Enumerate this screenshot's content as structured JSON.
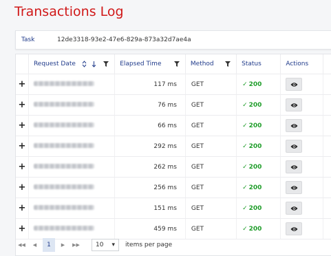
{
  "page_title": "Transactions Log",
  "task": {
    "label": "Task",
    "value": "12de3318-93e2-47e6-829a-873a32d7ae4a"
  },
  "columns": {
    "request_date": "Request Date",
    "elapsed_time": "Elapsed Time",
    "method": "Method",
    "status": "Status",
    "actions": "Actions"
  },
  "rows": [
    {
      "expand": "+",
      "elapsed": "117 ms",
      "method": "GET",
      "status": "200"
    },
    {
      "expand": "+",
      "elapsed": "76 ms",
      "method": "GET",
      "status": "200"
    },
    {
      "expand": "+",
      "elapsed": "66 ms",
      "method": "GET",
      "status": "200"
    },
    {
      "expand": "+",
      "elapsed": "292 ms",
      "method": "GET",
      "status": "200"
    },
    {
      "expand": "+",
      "elapsed": "262 ms",
      "method": "GET",
      "status": "200"
    },
    {
      "expand": "+",
      "elapsed": "256 ms",
      "method": "GET",
      "status": "200"
    },
    {
      "expand": "+",
      "elapsed": "151 ms",
      "method": "GET",
      "status": "200"
    },
    {
      "expand": "+",
      "elapsed": "459 ms",
      "method": "GET",
      "status": "200"
    }
  ],
  "pager": {
    "current_page": "1",
    "page_size": "10",
    "items_per_page_label": "items per page"
  },
  "colors": {
    "title": "#d01818",
    "header_text": "#1f3a8a",
    "status_ok": "#1f9d2a"
  }
}
